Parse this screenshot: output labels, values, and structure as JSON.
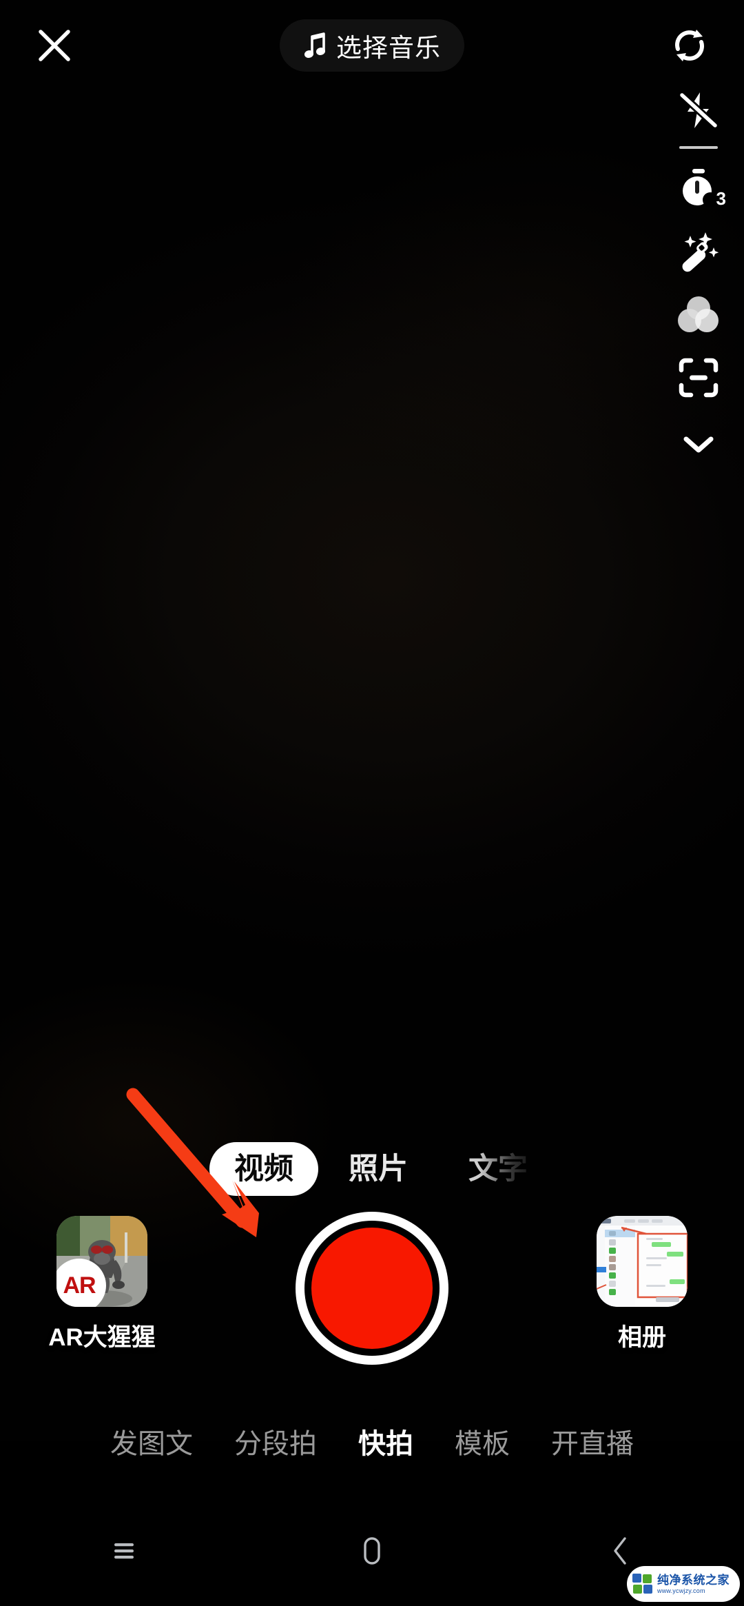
{
  "app": {
    "screen_name": "camera-capture",
    "background_color": "#000000"
  },
  "topbar": {
    "close_icon": "close-icon",
    "music_icon": "music-note-icon",
    "music_label": "选择音乐",
    "flip_icon": "camera-flip-icon"
  },
  "tool_rail": {
    "items": [
      {
        "icon": "flash-off-icon",
        "name": "flash-toggle"
      },
      {
        "icon": "timer-icon",
        "name": "countdown-timer",
        "badge": "3"
      },
      {
        "icon": "magic-wand-icon",
        "name": "beauty-effects"
      },
      {
        "icon": "filter-circles-icon",
        "name": "filters"
      },
      {
        "icon": "scan-frame-icon",
        "name": "scan"
      },
      {
        "icon": "chevron-down-icon",
        "name": "expand-tools"
      }
    ]
  },
  "mode_tabs": {
    "items": [
      {
        "label": "视频",
        "active": true
      },
      {
        "label": "照片",
        "active": false
      },
      {
        "label": "文字",
        "active": false,
        "faded": true
      }
    ]
  },
  "capture": {
    "effect": {
      "label": "AR大猩猩",
      "badge": "AR",
      "thumb_name": "ar-gorilla-thumbnail"
    },
    "record_button": {
      "name": "record-button",
      "color": "#f81800",
      "ring_color": "#ffffff"
    },
    "album": {
      "label": "相册",
      "thumb_name": "album-thumbnail"
    }
  },
  "bottom_nav": {
    "items": [
      {
        "label": "发图文",
        "active": false
      },
      {
        "label": "分段拍",
        "active": false
      },
      {
        "label": "快拍",
        "active": true
      },
      {
        "label": "模板",
        "active": false
      },
      {
        "label": "开直播",
        "active": false
      }
    ]
  },
  "system_nav": {
    "items": [
      {
        "icon": "menu-icon",
        "name": "recent-apps-button"
      },
      {
        "icon": "home-icon",
        "name": "home-button"
      },
      {
        "icon": "chevron-left-icon",
        "name": "back-button"
      }
    ]
  },
  "annotation": {
    "arrow_color": "#f53c15",
    "arrow_from": "193,1588",
    "arrow_to": "372,1795"
  },
  "watermark": {
    "title": "纯净系统之家",
    "url": "www.ycwjzy.com",
    "logo_colors": [
      "#2a63b8",
      "#4fa72b",
      "#2a63b8",
      "#4fa72b"
    ]
  }
}
